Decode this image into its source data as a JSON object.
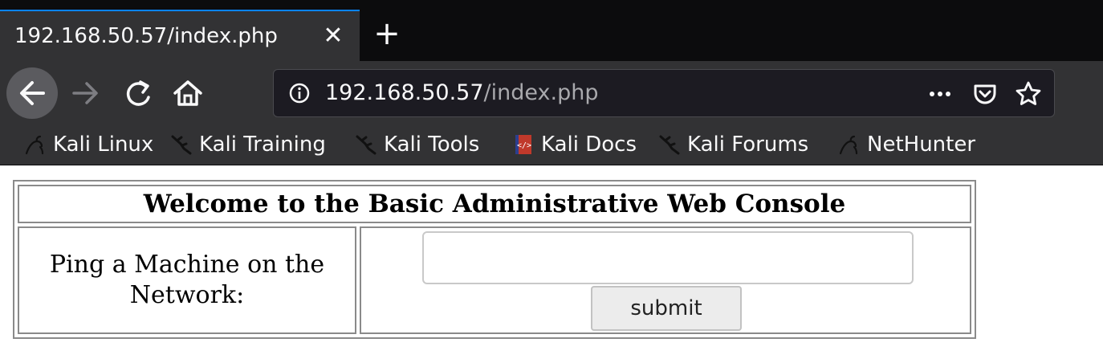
{
  "browser": {
    "tab": {
      "title": "192.168.50.57/index.php"
    },
    "urlbar": {
      "host": "192.168.50.57",
      "path": "/index.php"
    },
    "icons": {
      "back": "back-arrow-icon",
      "forward": "forward-arrow-icon",
      "reload": "reload-icon",
      "home": "home-icon",
      "info": "info-icon",
      "page_actions": "more-horizontal-icon",
      "pocket": "pocket-icon",
      "bookmark_star": "star-icon"
    },
    "bookmarks": [
      {
        "label": "Kali Linux",
        "icon": "kali-dragon-icon"
      },
      {
        "label": "Kali Training",
        "icon": "kali-dragon-icon"
      },
      {
        "label": "Kali Tools",
        "icon": "kali-dragon-icon"
      },
      {
        "label": "Kali Docs",
        "icon": "kali-docs-icon"
      },
      {
        "label": "Kali Forums",
        "icon": "kali-dragon-icon"
      },
      {
        "label": "NetHunter",
        "icon": "nethunter-icon"
      }
    ],
    "colors": {
      "accent": "#0a84ff",
      "chrome": "#323234",
      "tabstrip": "#0c0c0d"
    }
  },
  "page": {
    "heading": "Welcome to the Basic Administrative Web Console",
    "ping_label": "Ping a Machine on the Network:",
    "ping_input": {
      "value": "",
      "placeholder": ""
    },
    "submit_label": "submit"
  }
}
